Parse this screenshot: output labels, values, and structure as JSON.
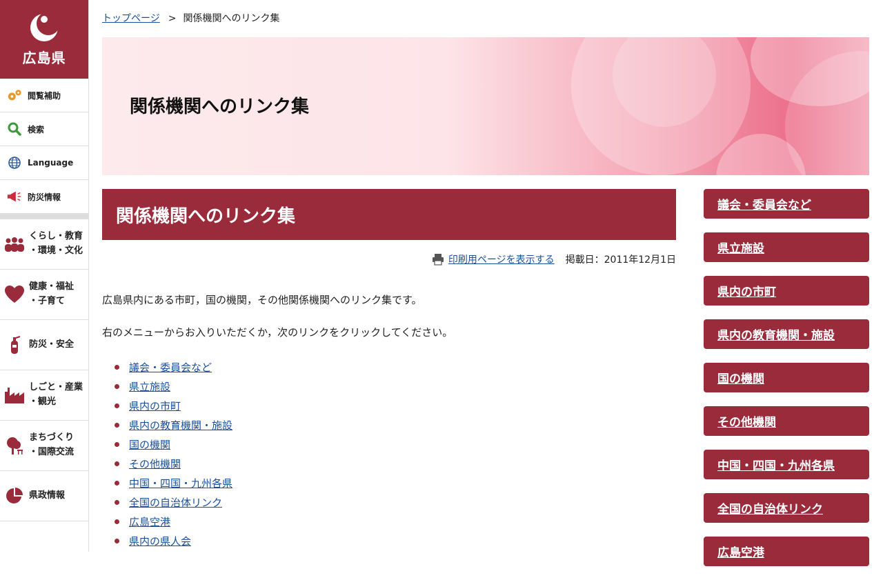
{
  "logo": {
    "name": "広島県"
  },
  "util_nav": [
    {
      "label": "閲覧補助",
      "icon": "gears-icon"
    },
    {
      "label": "検索",
      "icon": "search-icon"
    },
    {
      "label": "Language",
      "icon": "globe-icon"
    },
    {
      "label": "防災情報",
      "icon": "megaphone-icon"
    }
  ],
  "category_nav": [
    {
      "line1": "くらし・教育",
      "line2": "・環境・文化",
      "icon": "people-icon"
    },
    {
      "line1": "健康・福祉",
      "line2": "・子育て",
      "icon": "heart-icon"
    },
    {
      "line1": "防災・安全",
      "line2": "",
      "icon": "extinguisher-icon"
    },
    {
      "line1": "しごと・産業",
      "line2": "・観光",
      "icon": "factory-icon"
    },
    {
      "line1": "まちづくり",
      "line2": "・国際交流",
      "icon": "tree-icon"
    },
    {
      "line1": "県政情報",
      "line2": "",
      "icon": "pie-chart-icon"
    }
  ],
  "breadcrumb": {
    "home": "トップページ",
    "separator": ">",
    "current": "関係機関へのリンク集"
  },
  "hero": {
    "title": "関係機関へのリンク集"
  },
  "page": {
    "title": "関係機関へのリンク集",
    "print_link": "印刷用ページを表示する",
    "posted": "掲載日：2011年12月1日",
    "intro1": "広島県内にある市町，国の機関，その他関係機関へのリンク集です。",
    "intro2": "右のメニューからお入りいただくか，次のリンクをクリックしてください。",
    "links": [
      "議会・委員会など",
      "県立施設",
      "県内の市町",
      "県内の教育機関・施設",
      "国の機関",
      "その他機関",
      "中国・四国・九州各県",
      "全国の自治体リンク",
      "広島空港",
      "県内の県人会"
    ]
  },
  "right_menu": [
    "議会・委員会など",
    "県立施設",
    "県内の市町",
    "県内の教育機関・施設",
    "国の機関",
    "その他機関",
    "中国・四国・九州各県",
    "全国の自治体リンク",
    "広島空港"
  ],
  "colors": {
    "brand": "#9a2b3b",
    "link": "#1a4f9c"
  }
}
